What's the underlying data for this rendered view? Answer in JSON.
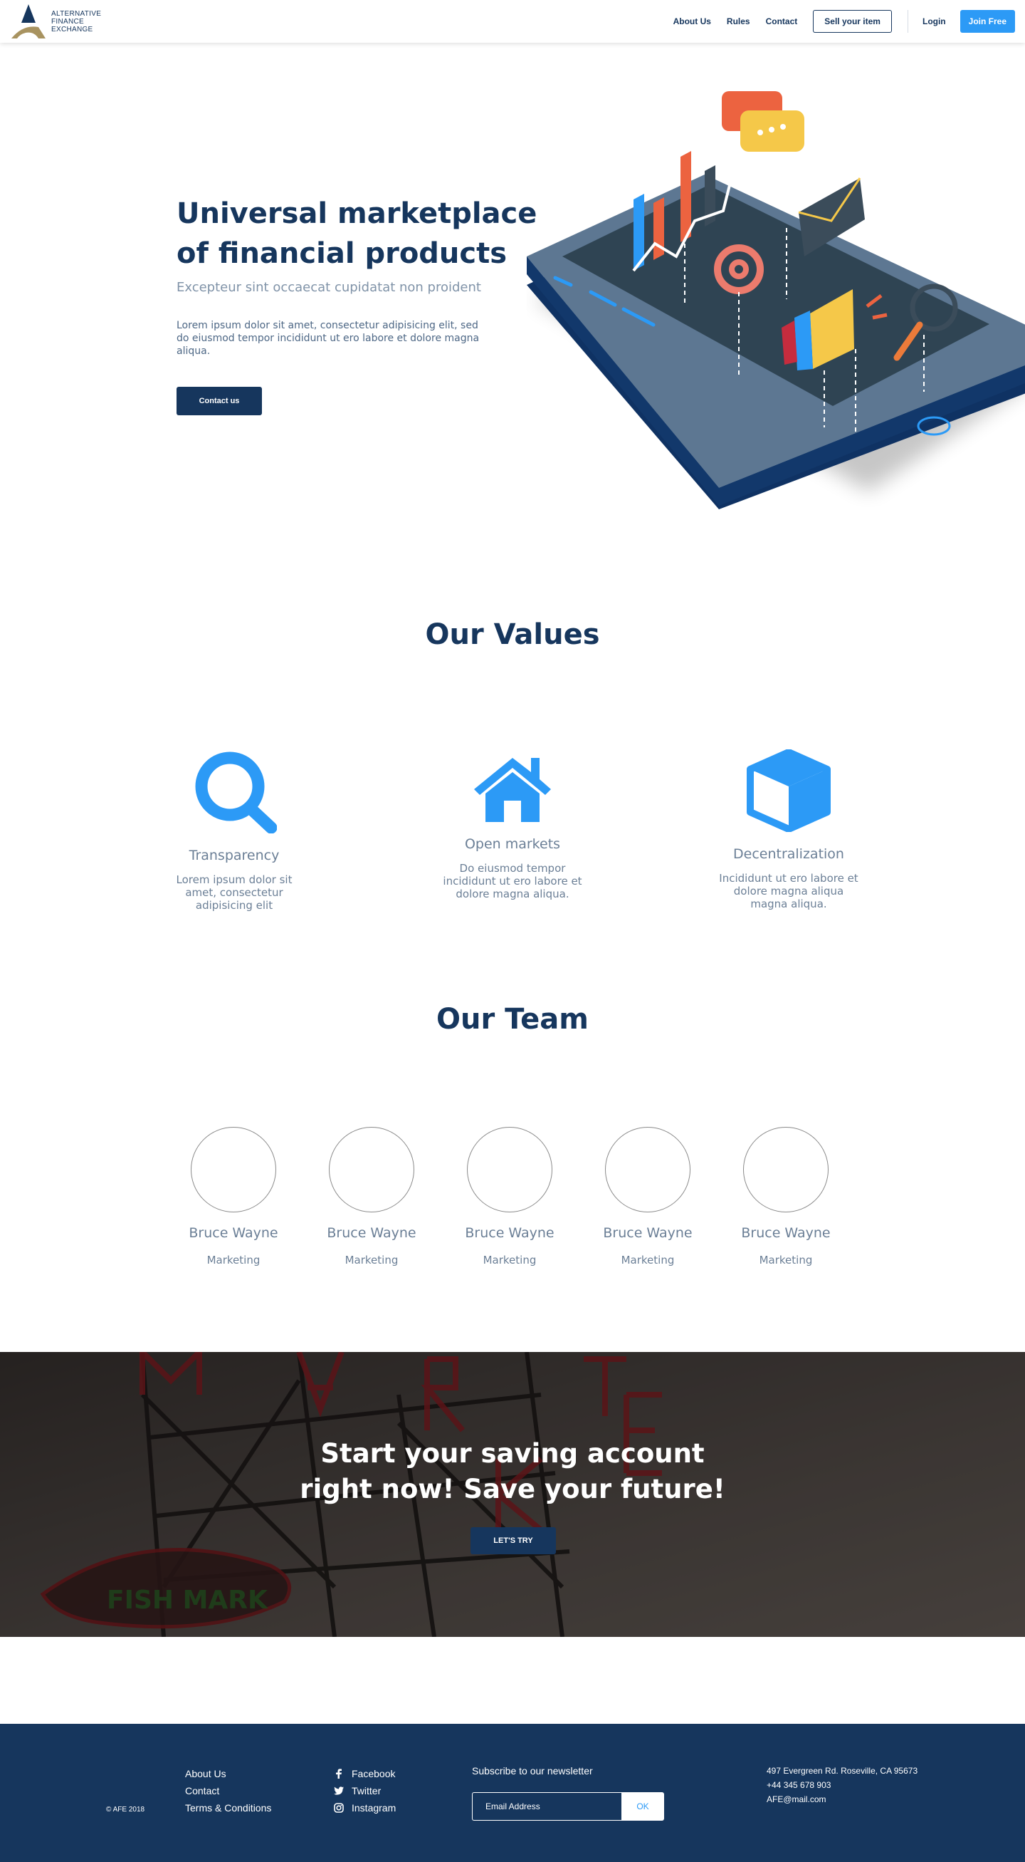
{
  "brand": {
    "logo_lines": [
      "ALTERNATIVE",
      "FINANCE",
      "EXCHANGE"
    ]
  },
  "nav": {
    "about": "About Us",
    "rules": "Rules",
    "contact": "Contact",
    "sell": "Sell your item",
    "login": "Login",
    "join": "Join Free"
  },
  "hero": {
    "title": "Universal marketplace of financial products",
    "subtitle": "Excepteur sint occaecat cupidatat non proident",
    "body": "Lorem ipsum dolor sit amet, consectetur adipisicing elit, sed do eiusmod tempor incididunt ut ero labore et dolore magna aliqua.",
    "cta": "Contact us"
  },
  "values": {
    "title": "Our Values",
    "items": [
      {
        "icon": "search-icon",
        "title": "Transparency",
        "text": "Lorem ipsum dolor sit amet, consectetur adipisicing elit"
      },
      {
        "icon": "home-icon",
        "title": "Open markets",
        "text": "Do eiusmod tempor incididunt ut ero labore et dolore magna aliqua."
      },
      {
        "icon": "cube-icon",
        "title": "Decentralization",
        "text": "Incididunt ut ero labore et dolore magna aliqua magna aliqua."
      }
    ]
  },
  "team": {
    "title": "Our Team",
    "members": [
      {
        "name": "Bruce Wayne",
        "role": "Marketing"
      },
      {
        "name": "Bruce Wayne",
        "role": "Marketing"
      },
      {
        "name": "Bruce Wayne",
        "role": "Marketing"
      },
      {
        "name": "Bruce Wayne",
        "role": "Marketing"
      },
      {
        "name": "Bruce Wayne",
        "role": "Marketing"
      }
    ]
  },
  "cta_banner": {
    "line1": "Start your saving account",
    "line2": "right now! Save your future!",
    "button": "LET'S TRY"
  },
  "footer": {
    "copyright": "© AFE 2018",
    "links": [
      "About Us",
      "Contact",
      "Terms & Conditions"
    ],
    "social": [
      {
        "icon": "facebook-icon",
        "label": "Facebook"
      },
      {
        "icon": "twitter-icon",
        "label": "Twitter"
      },
      {
        "icon": "instagram-icon",
        "label": "Instagram"
      }
    ],
    "newsletter_label": "Subscribe to our newsletter",
    "newsletter_placeholder": "Email Address",
    "newsletter_button": "OK",
    "address": "497 Evergreen Rd. Roseville, CA 95673",
    "phone": "+44 345 678 903",
    "email": "AFE@mail.com"
  },
  "colors": {
    "navy": "#16365d",
    "accent_blue": "#2c9af6",
    "muted_text": "#6b7f96",
    "gold": "#a89360"
  }
}
